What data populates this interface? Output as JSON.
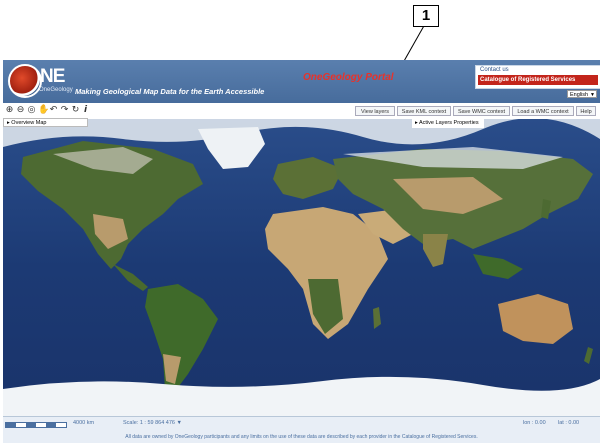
{
  "callout": {
    "number": "1"
  },
  "header": {
    "logo_text": "NE",
    "logo_sub": "OneGeology",
    "tagline": "Making Geological Map Data for the Earth Accessible",
    "portal_title": "OneGeology Portal",
    "contact_link": "Contact us",
    "catalogue_link": "Catalogue of Registered Services",
    "language": "English"
  },
  "toolbar": {
    "tools": [
      {
        "icon": "zoom-in-icon",
        "glyph": "⊕"
      },
      {
        "icon": "zoom-out-icon",
        "glyph": "⊖"
      },
      {
        "icon": "globe-icon",
        "glyph": "◎"
      },
      {
        "icon": "pan-hand-icon",
        "glyph": "✋"
      },
      {
        "icon": "previous-view-icon",
        "glyph": "↶"
      },
      {
        "icon": "next-view-icon",
        "glyph": "↷"
      },
      {
        "icon": "refresh-icon",
        "glyph": "↻"
      },
      {
        "icon": "info-icon",
        "glyph": "i"
      }
    ],
    "buttons": [
      "View layers",
      "Save KML context",
      "Save WMC context",
      "Load a WMC context",
      "Help"
    ]
  },
  "panels": {
    "overview_map": "Overview Map",
    "active_layers": "Active Layers Properties"
  },
  "status": {
    "scale_km": "4000 km",
    "scale_label": "Scale: 1 : 59 864 476",
    "lon": "lon : 0.00",
    "lat": "lat : 0.00"
  },
  "footer": "All data are owned by OneGeology participants and any limits on the use of these data are described by each provider in the Catalogue of Registered Services.",
  "colors": {
    "header": "#4a6fa0",
    "portal_title": "#e8322a",
    "catalogue_bg": "#c3251b",
    "ocean": "#1f3d78",
    "land": "#b89b6c",
    "forest": "#4a6a2e"
  }
}
